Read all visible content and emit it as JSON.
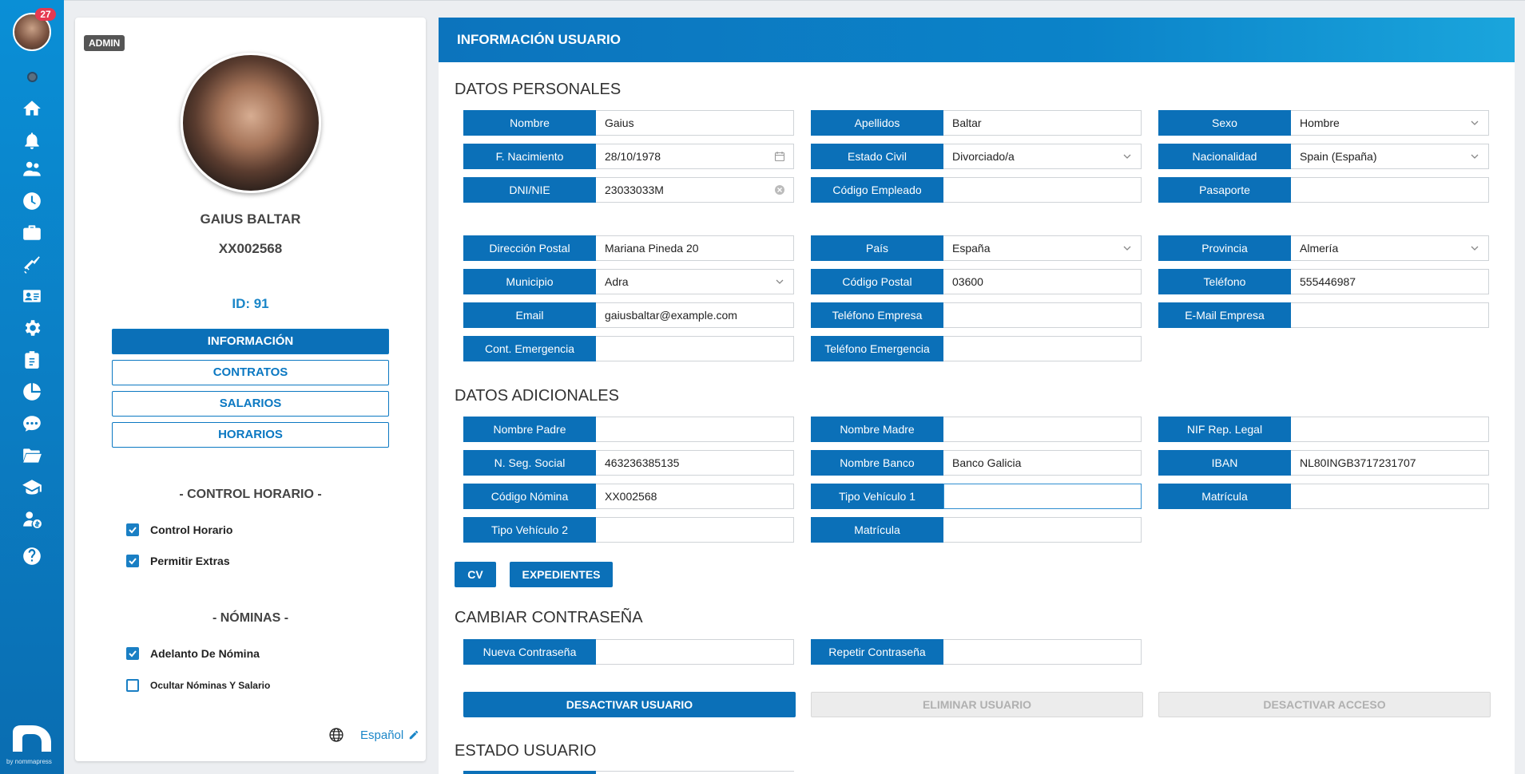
{
  "sidebar": {
    "notifications": "27",
    "icons": [
      "home-icon",
      "bell-icon",
      "users-icon",
      "clock-icon",
      "briefcase-icon",
      "tools-icon",
      "id-card-icon",
      "gear-icon",
      "clipboard-icon",
      "pie-chart-icon",
      "chat-icon",
      "folder-icon",
      "graduation-cap-icon",
      "user-money-icon",
      "help-icon"
    ],
    "brand_text": "by nommapress"
  },
  "profile": {
    "badge": "ADMIN",
    "name": "GAIUS BALTAR",
    "code": "XX002568",
    "id": "ID: 91",
    "buttons": [
      "INFORMACIÓN",
      "CONTRATOS",
      "SALARIOS",
      "HORARIOS"
    ],
    "control_title": "- CONTROL HORARIO -",
    "control_items": [
      {
        "label": "Control Horario",
        "checked": true
      },
      {
        "label": "Permitir Extras",
        "checked": true
      }
    ],
    "nominas_title": "- NÓMINAS -",
    "nominas_items": [
      {
        "label": "Adelanto De Nómina",
        "checked": true
      },
      {
        "label": "Ocultar Nóminas Y Salario",
        "checked": false
      }
    ],
    "language": "Español"
  },
  "main": {
    "title": "INFORMACIÓN USUARIO",
    "personal_title": "DATOS PERSONALES",
    "personal": {
      "nombre": {
        "label": "Nombre",
        "value": "Gaius"
      },
      "apellidos": {
        "label": "Apellidos",
        "value": "Baltar"
      },
      "sexo": {
        "label": "Sexo",
        "value": "Hombre"
      },
      "nacimiento": {
        "label": "F. Nacimiento",
        "value": "28/10/1978"
      },
      "estado_civil": {
        "label": "Estado Civil",
        "value": "Divorciado/a"
      },
      "nacionalidad": {
        "label": "Nacionalidad",
        "value": "Spain (España)"
      },
      "dni": {
        "label": "DNI/NIE",
        "value": "23033033M"
      },
      "codigo_empleado": {
        "label": "Código Empleado",
        "value": ""
      },
      "pasaporte": {
        "label": "Pasaporte",
        "value": ""
      },
      "direccion": {
        "label": "Dirección Postal",
        "value": "Mariana Pineda 20"
      },
      "pais": {
        "label": "País",
        "value": "España"
      },
      "provincia": {
        "label": "Provincia",
        "value": "Almería"
      },
      "municipio": {
        "label": "Municipio",
        "value": "Adra"
      },
      "codigo_postal": {
        "label": "Código Postal",
        "value": "03600"
      },
      "telefono": {
        "label": "Teléfono",
        "value": "555446987"
      },
      "email": {
        "label": "Email",
        "value": "gaiusbaltar@example.com"
      },
      "telefono_empresa": {
        "label": "Teléfono Empresa",
        "value": ""
      },
      "email_empresa": {
        "label": "E-Mail Empresa",
        "value": ""
      },
      "cont_emergencia": {
        "label": "Cont. Emergencia",
        "value": ""
      },
      "telefono_emergencia": {
        "label": "Teléfono Emergencia",
        "value": ""
      }
    },
    "additional_title": "DATOS ADICIONALES",
    "additional": {
      "nombre_padre": {
        "label": "Nombre Padre",
        "value": ""
      },
      "nombre_madre": {
        "label": "Nombre Madre",
        "value": ""
      },
      "nif_rep": {
        "label": "NIF Rep. Legal",
        "value": ""
      },
      "seg_social": {
        "label": "N. Seg. Social",
        "value": "463236385135"
      },
      "nombre_banco": {
        "label": "Nombre Banco",
        "value": "Banco Galicia"
      },
      "iban": {
        "label": "IBAN",
        "value": "NL80INGB3717231707"
      },
      "codigo_nomina": {
        "label": "Código Nómina",
        "value": "XX002568"
      },
      "tipo_vehiculo_1": {
        "label": "Tipo Vehículo 1",
        "value": ""
      },
      "matricula_1": {
        "label": "Matrícula",
        "value": ""
      },
      "tipo_vehiculo_2": {
        "label": "Tipo Vehículo 2",
        "value": ""
      },
      "matricula_2": {
        "label": "Matrícula",
        "value": ""
      }
    },
    "btn_cv": "CV",
    "btn_expedientes": "EXPEDIENTES",
    "password_title": "CAMBIAR CONTRASEÑA",
    "password": {
      "nueva": {
        "label": "Nueva Contraseña",
        "value": ""
      },
      "repetir": {
        "label": "Repetir Contraseña",
        "value": ""
      }
    },
    "btn_desactivar_usuario": "DESACTIVAR USUARIO",
    "btn_eliminar_usuario": "ELIMINAR USUARIO",
    "btn_desactivar_acceso": "DESACTIVAR ACCESO",
    "estado_title": "ESTADO USUARIO"
  }
}
